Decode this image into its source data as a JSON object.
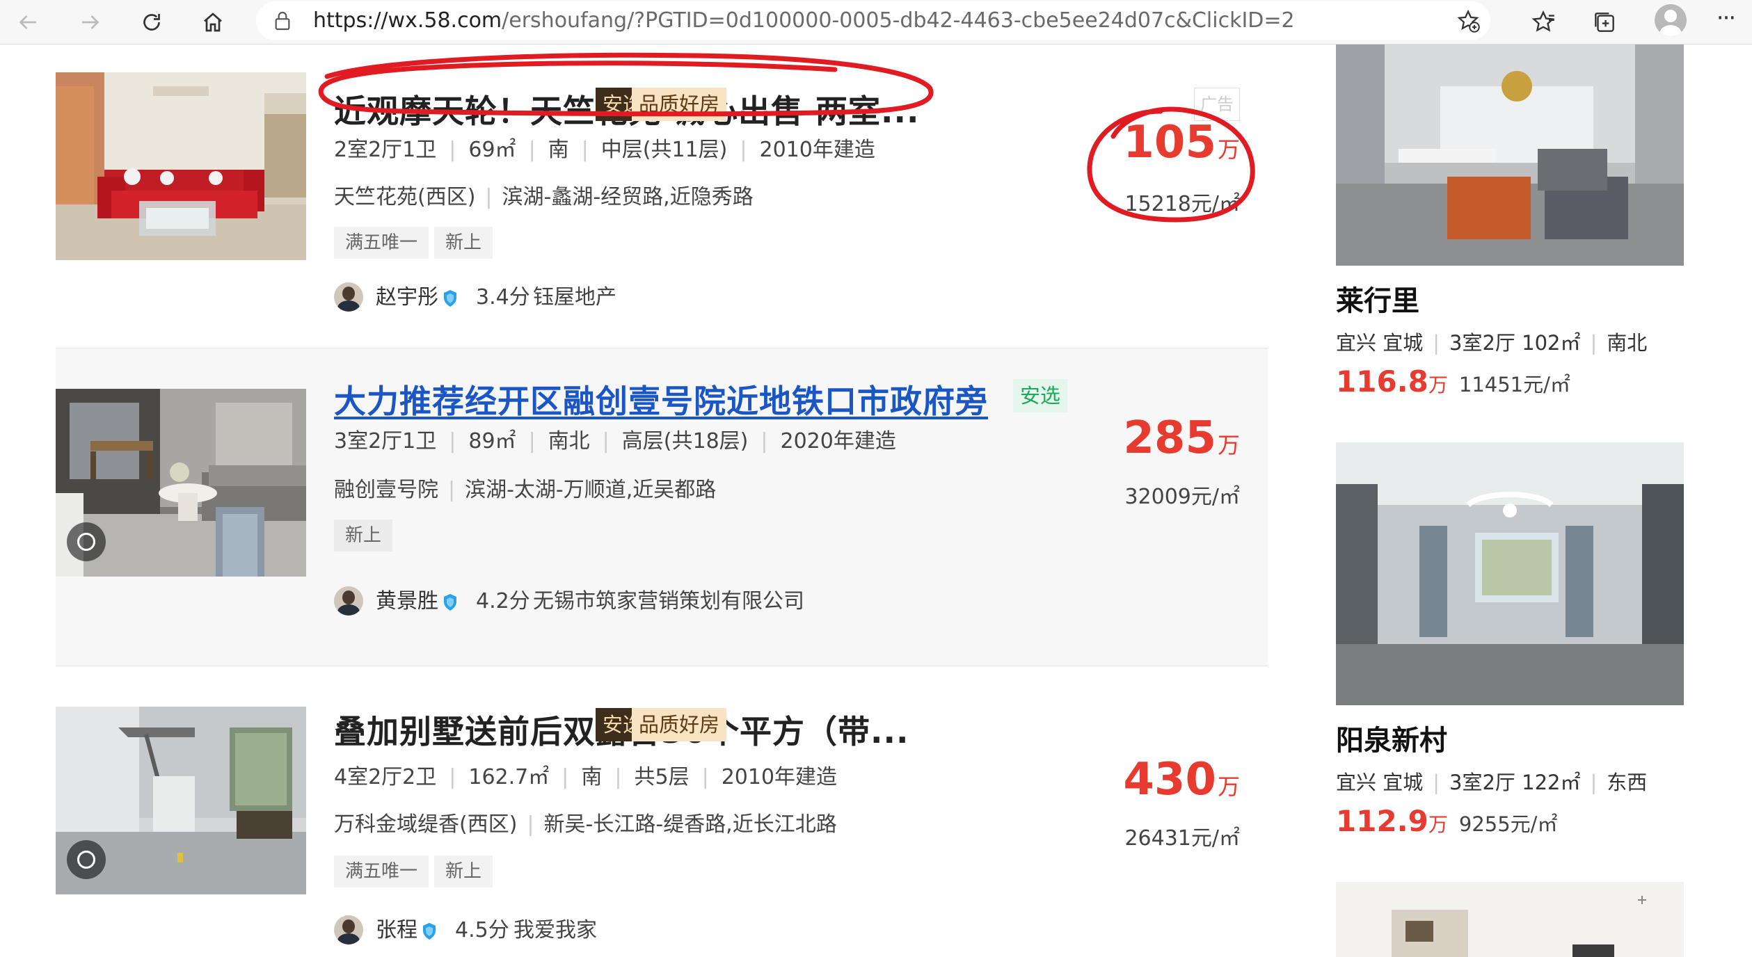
{
  "browser": {
    "url_host": "https://wx.58.com",
    "url_path": "/ershoufang/?PGTID=0d100000-0005-db42-4463-cbe5ee24d07c&ClickID=2"
  },
  "listings": [
    {
      "title": "近观摩天轮！天竺花苑 诚心出售 两室...",
      "badges": [
        "安选",
        "品质好房"
      ],
      "ad_label": "广告",
      "info": [
        "2室2厅1卫",
        "69㎡",
        "南",
        "中层(共11层)",
        "2010年建造"
      ],
      "community": "天竺花苑(西区)",
      "location": "滨湖-蠡湖-经贸路,近隐秀路",
      "tags": [
        "满五唯一",
        "新上"
      ],
      "agent_name": "赵宇彤",
      "agent_score": "3.4分",
      "agent_company": "钰屋地产",
      "price": "105",
      "price_unit": "万",
      "unit_price": "15218元/㎡"
    },
    {
      "title": "大力推荐经开区融创壹号院近地铁口市政府旁",
      "badges": [
        "安选"
      ],
      "info": [
        "3室2厅1卫",
        "89㎡",
        "南北",
        "高层(共18层)",
        "2020年建造"
      ],
      "community": "融创壹号院",
      "location": "滨湖-太湖-万顺道,近吴都路",
      "tags": [
        "新上"
      ],
      "agent_name": "黄景胜",
      "agent_score": "4.2分",
      "agent_company": "无锡市筑家营销策划有限公司",
      "price": "285",
      "price_unit": "万",
      "unit_price": "32009元/㎡"
    },
    {
      "title": "叠加别墅送前后双露台30个平方（带...",
      "badges": [
        "安选",
        "品质好房"
      ],
      "info": [
        "4室2厅2卫",
        "162.7㎡",
        "南",
        "共5层",
        "2010年建造"
      ],
      "community": "万科金域缇香(西区)",
      "location": "新吴-长江路-缇香路,近长江北路",
      "tags": [
        "满五唯一",
        "新上"
      ],
      "agent_name": "张程",
      "agent_score": "4.5分",
      "agent_company": "我爱我家",
      "price": "430",
      "price_unit": "万",
      "unit_price": "26431元/㎡"
    }
  ],
  "recommendations": [
    {
      "name": "莱行里",
      "info": [
        "宜兴 宜城",
        "3室2厅 102㎡",
        "南北"
      ],
      "price": "116.8",
      "price_unit": "万",
      "unit_price": "11451元/㎡"
    },
    {
      "name": "阳泉新村",
      "info": [
        "宜兴 宜城",
        "3室2厅 122㎡",
        "东西"
      ],
      "price": "112.9",
      "price_unit": "万",
      "unit_price": "9255元/㎡"
    }
  ],
  "colors": {
    "price_red": "#e83b2f",
    "link_blue": "#1a56c6",
    "anxuan_bg": "#3d2d1a",
    "pinzhi_bg": "#f9e3c2",
    "annotation_red": "#e11b22"
  }
}
